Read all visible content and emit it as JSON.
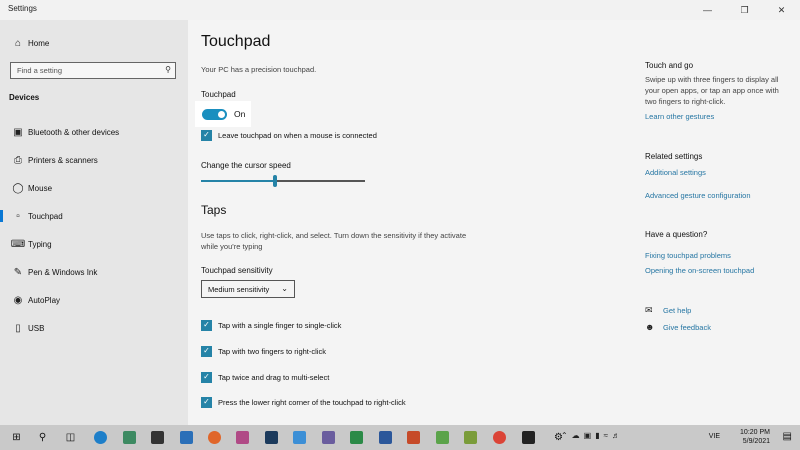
{
  "window": {
    "title": "Settings",
    "min_icon": "minimize-icon",
    "max_icon": "maximize-icon",
    "close_icon": "close-icon"
  },
  "sidebar": {
    "home": "Home",
    "search_placeholder": "Find a setting",
    "section": "Devices",
    "items": [
      {
        "label": "Bluetooth & other devices",
        "icon": "bluetooth-icon"
      },
      {
        "label": "Printers & scanners",
        "icon": "printer-icon"
      },
      {
        "label": "Mouse",
        "icon": "mouse-icon"
      },
      {
        "label": "Touchpad",
        "icon": "touchpad-icon",
        "active": true
      },
      {
        "label": "Typing",
        "icon": "keyboard-icon"
      },
      {
        "label": "Pen & Windows Ink",
        "icon": "pen-icon"
      },
      {
        "label": "AutoPlay",
        "icon": "autoplay-icon"
      },
      {
        "label": "USB",
        "icon": "usb-icon"
      }
    ],
    "accent_color": "#0a78d4"
  },
  "main": {
    "title": "Touchpad",
    "subtitle": "Your PC has a precision touchpad.",
    "touchpad_label": "Touchpad",
    "toggle_state": "On",
    "leave_on": "Leave touchpad on when a mouse is connected",
    "cursor_speed_label": "Change the cursor speed",
    "cursor_speed_fraction": 0.44,
    "taps_heading": "Taps",
    "taps_desc": "Use taps to click, right-click, and select. Turn down the sensitivity if they activate while you're typing",
    "sensitivity_label": "Touchpad sensitivity",
    "sensitivity_value": "Medium sensitivity",
    "tap_options": [
      "Tap with a single finger to single-click",
      "Tap with two fingers to right-click",
      "Tap twice and drag to multi-select",
      "Press the lower right corner of the touchpad to right-click"
    ],
    "accent_color": "#2583a7"
  },
  "right": {
    "touch_go_heading": "Touch and go",
    "touch_go_desc": "Swipe up with three fingers to display all your open apps, or tap an app once with two fingers to right-click.",
    "learn_link": "Learn other gestures",
    "related_heading": "Related settings",
    "additional_link": "Additional settings",
    "advanced_link": "Advanced gesture configuration",
    "question_heading": "Have a question?",
    "fixing_link": "Fixing touchpad problems",
    "opening_link": "Opening the on-screen touchpad",
    "get_help": "Get help",
    "give_feedback": "Give feedback",
    "link_color": "#2676a3"
  },
  "taskbar": {
    "language": "VIE",
    "time": "10:20 PM",
    "date": "5/9/2021"
  }
}
